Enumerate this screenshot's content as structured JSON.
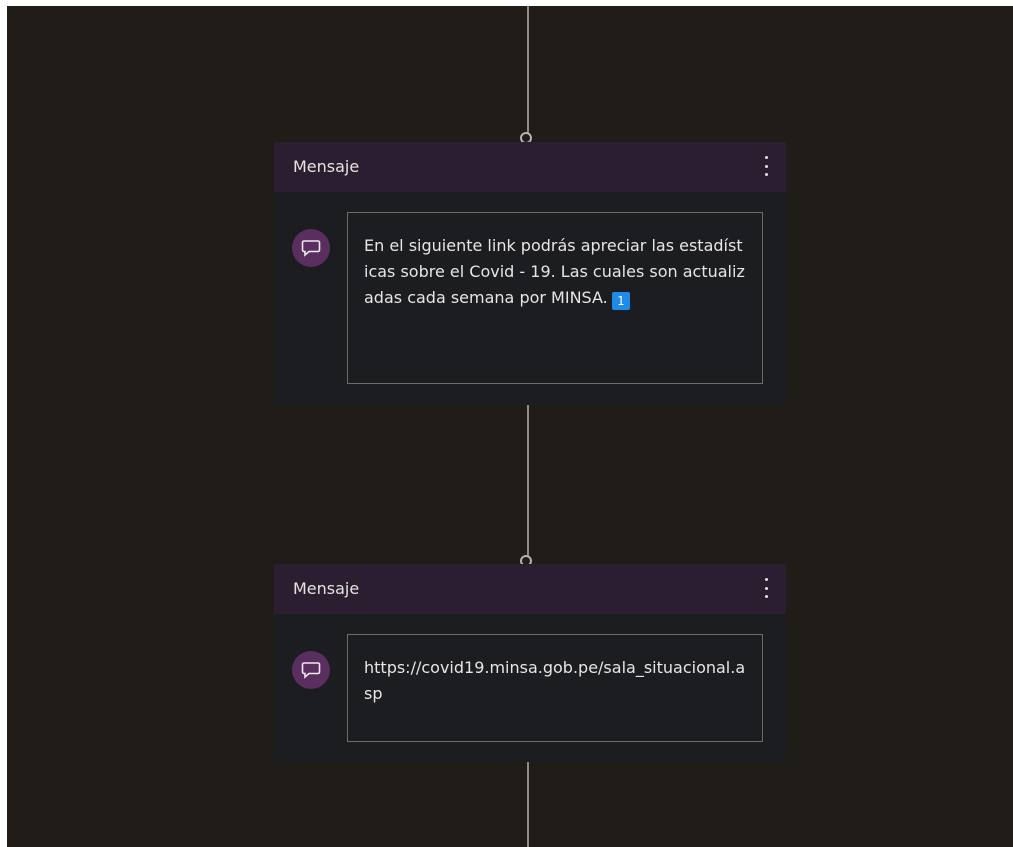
{
  "colors": {
    "canvas_bg": "#201d19",
    "node_header_bg": "#2b1e30",
    "node_body_bg": "#1c1d21",
    "icon_bg": "#5a2f5f",
    "badge_bg": "#1e8be8",
    "connector": "#8e8b88"
  },
  "nodes": [
    {
      "title": "Mensaje",
      "menu_icon": "more-vertical-icon",
      "type_icon": "chat-bubble-icon",
      "message_text": "En el siguiente link podrás apreciar las estadísticas sobre el Covid - 19. Las cuales son actualizadas cada semana por MINSA.",
      "emoji_badge": "1"
    },
    {
      "title": "Mensaje",
      "menu_icon": "more-vertical-icon",
      "type_icon": "chat-bubble-icon",
      "message_text": "https://covid19.minsa.gob.pe/sala_situacional.asp"
    }
  ]
}
